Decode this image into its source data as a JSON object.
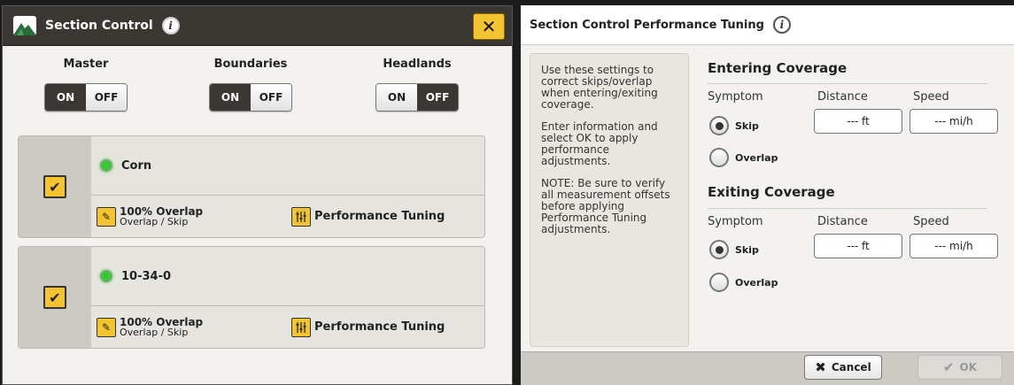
{
  "section_control": {
    "title": "Section Control",
    "info_icon": "i",
    "close_icon": "✕",
    "master": {
      "label": "Master",
      "on": "ON",
      "off": "OFF",
      "state": "on"
    },
    "boundaries": {
      "label": "Boundaries",
      "on": "ON",
      "off": "OFF",
      "state": "on"
    },
    "headlands": {
      "label": "Headlands",
      "on": "ON",
      "off": "OFF",
      "state": "off"
    },
    "products": [
      {
        "name": "Corn",
        "checked": true,
        "status_color": "#2ecc2e",
        "overlap_main": "100% Overlap",
        "overlap_sub": "Overlap / Skip",
        "tuning": "Performance Tuning"
      },
      {
        "name": "10-34-0",
        "checked": true,
        "status_color": "#2ecc2e",
        "overlap_main": "100% Overlap",
        "overlap_sub": "Overlap / Skip",
        "tuning": "Performance Tuning"
      }
    ]
  },
  "tuning_panel": {
    "title": "Section Control Performance Tuning",
    "info_icon": "i",
    "help": [
      "Use these settings to correct skips/overlap when entering/exiting coverage.",
      "Enter information and select OK to apply performance adjustments.",
      "NOTE: Be sure to verify all measurement offsets before applying Performance Tuning adjustments."
    ],
    "entering": {
      "heading": "Entering Coverage",
      "symptom_label": "Symptom",
      "distance_label": "Distance",
      "speed_label": "Speed",
      "skip": "Skip",
      "overlap": "Overlap",
      "selected": "skip",
      "distance_value": "--- ft",
      "speed_value": "--- mi/h"
    },
    "exiting": {
      "heading": "Exiting Coverage",
      "symptom_label": "Symptom",
      "distance_label": "Distance",
      "speed_label": "Speed",
      "skip": "Skip",
      "overlap": "Overlap",
      "selected": "skip",
      "distance_value": "--- ft",
      "speed_value": "--- mi/h"
    },
    "cancel": "Cancel",
    "ok": "OK"
  },
  "colors": {
    "accent": "#f4c430",
    "titlebar": "#3b3833",
    "status_on": "#2ecc2e"
  }
}
